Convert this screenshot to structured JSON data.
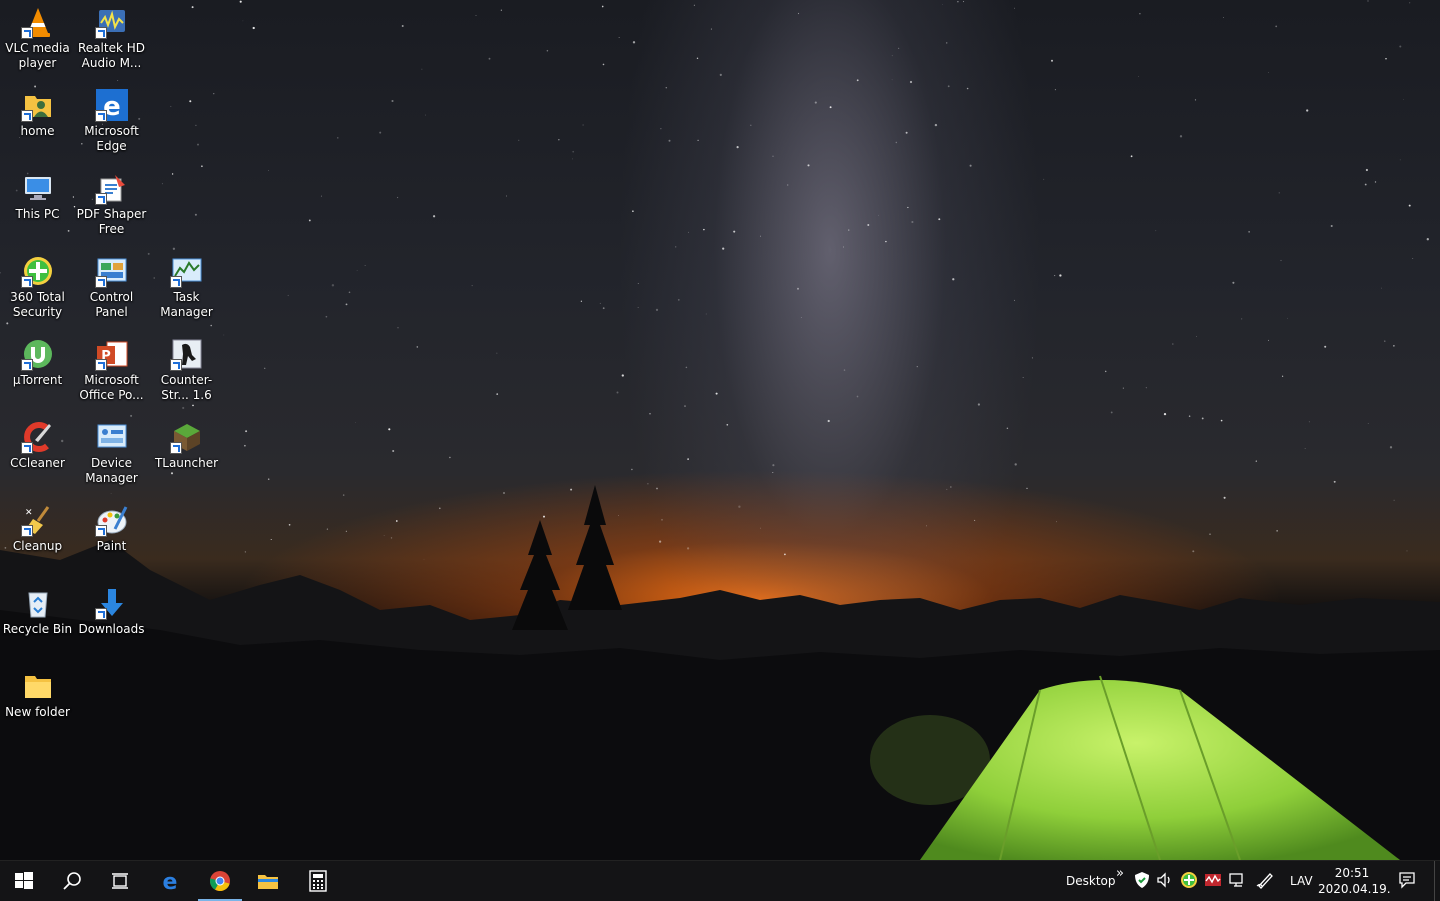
{
  "desktop": {
    "icons": [
      {
        "label": "VLC media player",
        "icon": "vlc-icon"
      },
      {
        "label": "Realtek HD Audio M...",
        "icon": "realtek-audio-icon"
      },
      {
        "label": "home",
        "icon": "user-folder-icon"
      },
      {
        "label": "Microsoft Edge",
        "icon": "edge-icon"
      },
      {
        "label": "This PC",
        "icon": "computer-icon"
      },
      {
        "label": "PDF Shaper Free",
        "icon": "pdf-shaper-icon"
      },
      {
        "label": "360 Total Security",
        "icon": "security-360-icon"
      },
      {
        "label": "Control Panel",
        "icon": "control-panel-icon"
      },
      {
        "label": "Task Manager",
        "icon": "task-manager-icon"
      },
      {
        "label": "µTorrent",
        "icon": "utorrent-icon"
      },
      {
        "label": "Microsoft Office Po...",
        "icon": "powerpoint-icon"
      },
      {
        "label": "Counter-Str... 1.6",
        "icon": "counter-strike-icon"
      },
      {
        "label": "CCleaner",
        "icon": "ccleaner-icon"
      },
      {
        "label": "Device Manager",
        "icon": "device-manager-icon"
      },
      {
        "label": "TLauncher",
        "icon": "tlauncher-icon"
      },
      {
        "label": "Cleanup",
        "icon": "broom-icon"
      },
      {
        "label": "Paint",
        "icon": "paint-icon"
      },
      {
        "label": "Recycle Bin",
        "icon": "recycle-bin-icon"
      },
      {
        "label": "Downloads",
        "icon": "download-arrow-icon"
      },
      {
        "label": "New folder",
        "icon": "folder-icon"
      }
    ]
  },
  "taskbar": {
    "toolbar_label": "Desktop",
    "overflow_label": "»",
    "language": "LAV",
    "time": "20:51",
    "date": "2020.04.19.",
    "pinned": [
      "start-icon",
      "search-icon",
      "task-view-icon",
      "edge-icon",
      "chrome-icon",
      "file-explorer-icon",
      "calculator-icon"
    ]
  },
  "colors": {
    "taskbar_bg": "#141416",
    "active_indicator": "#7ab4e8",
    "tent_green": "#9ee04a"
  }
}
